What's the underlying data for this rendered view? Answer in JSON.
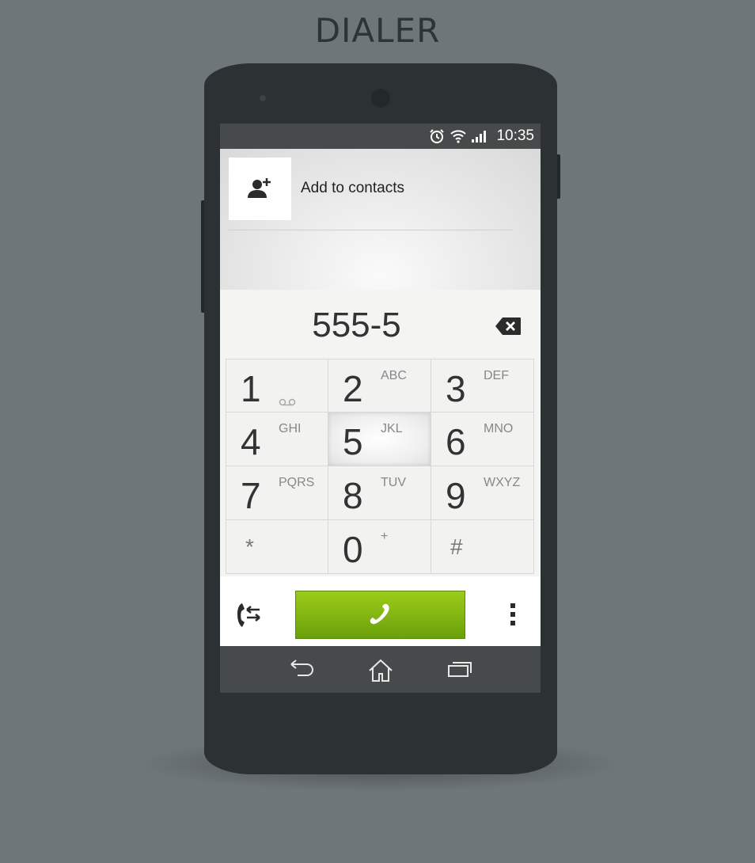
{
  "page": {
    "title": "DIALER"
  },
  "status_bar": {
    "time": "10:35",
    "icons": [
      "alarm-icon",
      "wifi-icon",
      "signal-icon"
    ]
  },
  "contacts": {
    "add_label": "Add to contacts",
    "icon": "add-contact-icon"
  },
  "dialer": {
    "number": "555-5",
    "backspace_icon": "backspace-icon",
    "keys": [
      {
        "digit": "1",
        "letters": "",
        "icon": "voicemail-icon"
      },
      {
        "digit": "2",
        "letters": "ABC"
      },
      {
        "digit": "3",
        "letters": "DEF"
      },
      {
        "digit": "4",
        "letters": "GHI"
      },
      {
        "digit": "5",
        "letters": "JKL",
        "pressed": true
      },
      {
        "digit": "6",
        "letters": "MNO"
      },
      {
        "digit": "7",
        "letters": "PQRS"
      },
      {
        "digit": "8",
        "letters": "TUV"
      },
      {
        "digit": "9",
        "letters": "WXYZ"
      },
      {
        "digit": "*",
        "letters": ""
      },
      {
        "digit": "0",
        "letters": "+"
      },
      {
        "digit": "#",
        "letters": ""
      }
    ]
  },
  "actions": {
    "left_icon": "call-transfer-icon",
    "call_icon": "phone-icon",
    "right_icon": "overflow-menu-icon"
  },
  "navbar": {
    "icons": [
      "back-icon",
      "home-icon",
      "recent-apps-icon"
    ]
  },
  "colors": {
    "call_green": "#7db80f",
    "phone_body": "#2c3234",
    "background": "#6f7679"
  }
}
